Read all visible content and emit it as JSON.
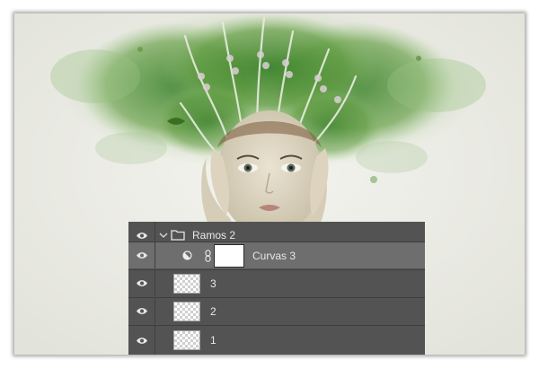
{
  "layers_panel": {
    "group": {
      "name": "Ramos 2",
      "expanded": true
    },
    "layers": [
      {
        "name": "Curvas 3",
        "type": "adjustment-curves",
        "selected": true
      },
      {
        "name": "3",
        "type": "pixel"
      },
      {
        "name": "2",
        "type": "pixel"
      },
      {
        "name": "1",
        "type": "pixel"
      }
    ]
  },
  "icons": {
    "visibility": "eye-icon",
    "disclosure": "chevron-down-icon",
    "group": "folder-icon",
    "adjustment": "half-circle-adjustment-icon",
    "link": "chain-link-icon"
  },
  "colors": {
    "panel_bg": "#535353",
    "selected_row": "#6e6e6e",
    "canvas_bg": "#ecece6",
    "foliage": "#4a8a2c"
  }
}
